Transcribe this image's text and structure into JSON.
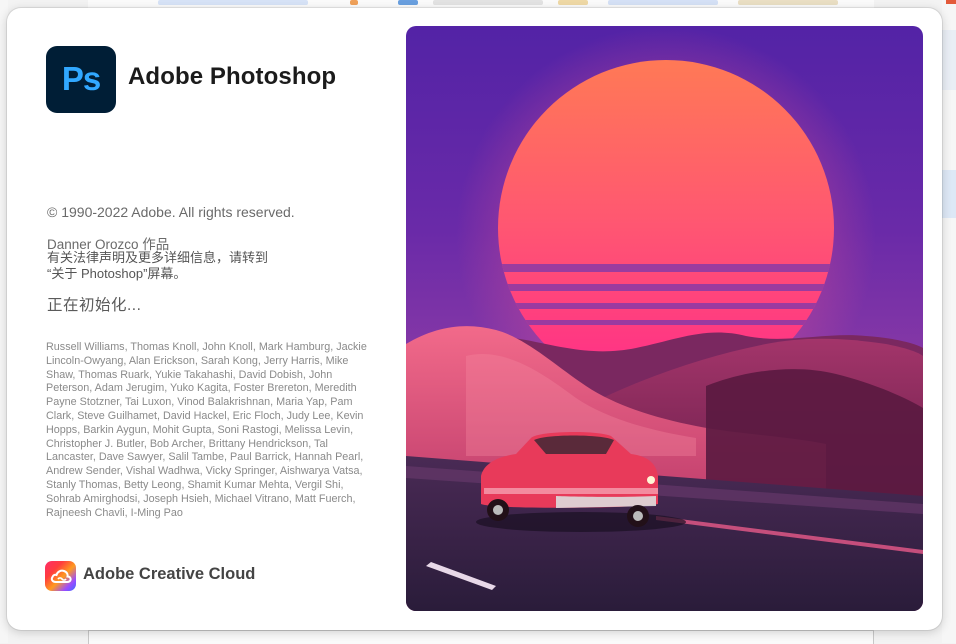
{
  "app": {
    "logo_text": "Ps",
    "name": "Adobe Photoshop"
  },
  "info": {
    "copyright": "© 1990-2022 Adobe. All rights reserved.",
    "artwork_by": "Danner Orozco 作品",
    "legal_line1": "有关法律声明及更多详细信息，请转到",
    "legal_line2": "“关于 Photoshop”屏幕。",
    "status": "正在初始化..."
  },
  "credits": "Russell Williams, Thomas Knoll, John Knoll, Mark Hamburg, Jackie Lincoln-Owyang, Alan Erickson, Sarah Kong, Jerry Harris, Mike Shaw, Thomas Ruark, Yukie Takahashi, David Dobish, John Peterson, Adam Jerugim, Yuko Kagita, Foster Brereton, Meredith Payne Stotzner, Tai Luxon, Vinod Balakrishnan, Maria Yap, Pam Clark, Steve Guilhamet, David Hackel, Eric Floch, Judy Lee, Kevin Hopps, Barkin Aygun, Mohit Gupta, Soni Rastogi, Melissa Levin, Christopher J. Butler, Bob Archer, Brittany Hendrickson, Tal Lancaster, Dave Sawyer, Salil Tambe, Paul Barrick, Hannah Pearl, Andrew Sender, Vishal Wadhwa, Vicky Springer, Aishwarya Vatsa, Stanly Thomas, Betty Leong, Shamit Kumar Mehta, Vergil Shi, Sohrab Amirghodsi, Joseph Hsieh, Michael Vitrano, Matt Fuerch, Rajneesh Chavli, I-Ming Pao",
  "footer": {
    "brand": "Adobe Creative Cloud",
    "icon": "creative-cloud-icon"
  },
  "colors": {
    "ps_bg": "#001e36",
    "ps_blue": "#31a8ff",
    "sky_top": "#5a24a8",
    "sun_top": "#ff7a55",
    "sun_bottom": "#ff2a8a"
  }
}
